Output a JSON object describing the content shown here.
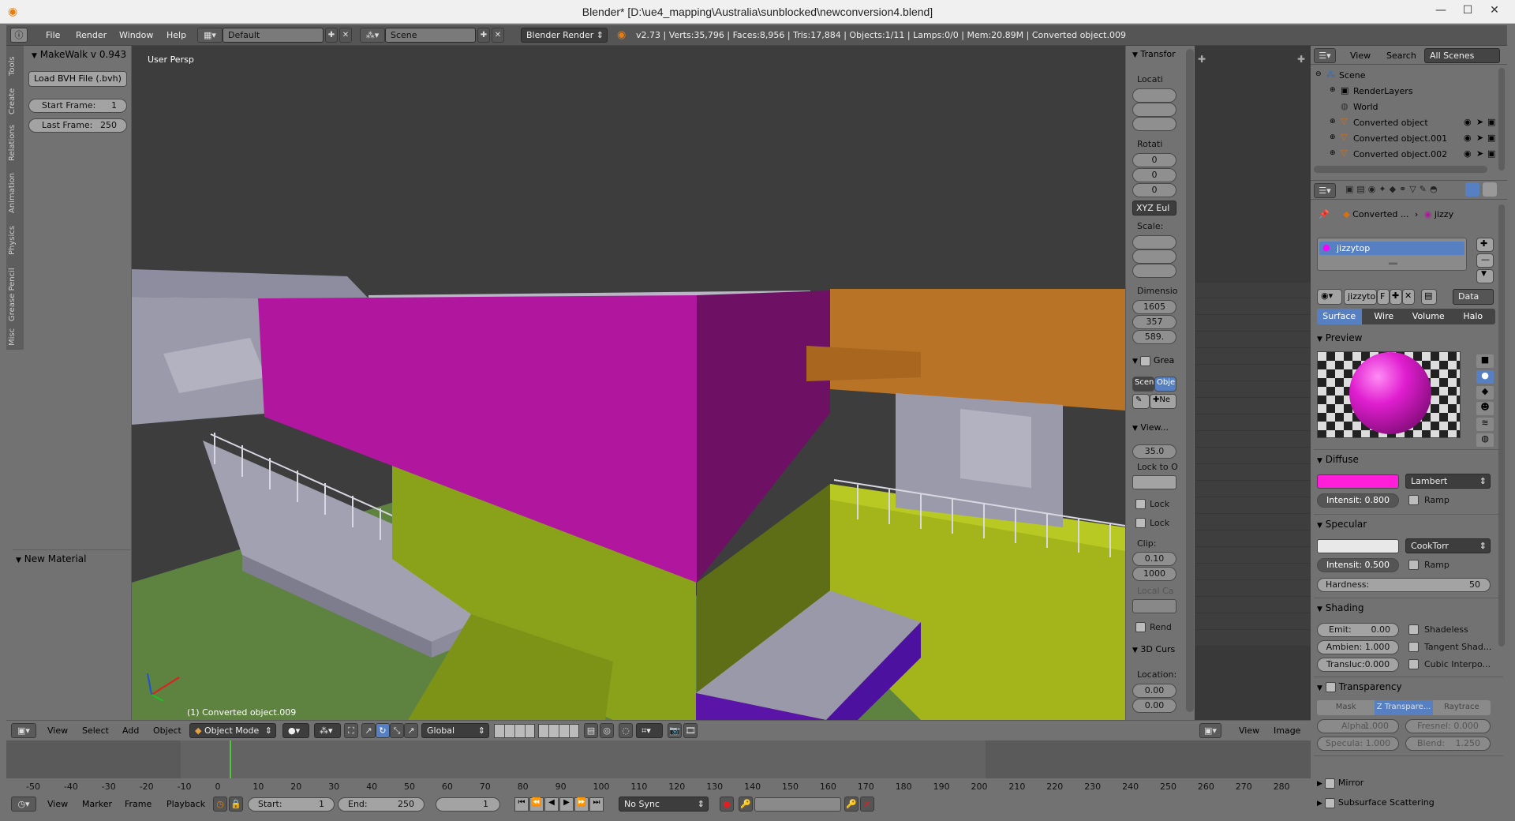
{
  "window": {
    "title": "Blender* [D:\\ue4_mapping\\Australia\\sunblocked\\newconversion4.blend]"
  },
  "infobar": {
    "menus": [
      "File",
      "Render",
      "Window",
      "Help"
    ],
    "layout": "Default",
    "scene": "Scene",
    "engine": "Blender Render",
    "stats": "v2.73 | Verts:35,796 | Faces:8,956 | Tris:17,884 | Objects:1/11 | Lamps:0/0 | Mem:20.89M | Converted object.009"
  },
  "toolshelf": {
    "tabs": [
      "Tools",
      "Create",
      "Relations",
      "Animation",
      "Physics",
      "Grease Pencil",
      "Misc"
    ],
    "panel_title": "MakeWalk v 0.943",
    "load_bvh": "Load BVH File (.bvh)",
    "start_frame_label": "Start Frame:",
    "start_frame_value": "1",
    "last_frame_label": "Last Frame:",
    "last_frame_value": "250",
    "operator_panel": "New Material"
  },
  "viewport": {
    "label": "User Persp",
    "object_label": "(1) Converted object.009",
    "colors": {
      "magenta": "#b0169e",
      "magenta_dark": "#6e1164",
      "lime": "#8aa11a",
      "lime_dark": "#5d6e16",
      "orange": "#b97327",
      "purple": "#5b14a8",
      "grey": "#9b9aaa",
      "ground": "#5e8240"
    }
  },
  "npanel": {
    "transform": "Transfor",
    "location": "Locati",
    "rotation": "Rotati",
    "rot_values": [
      "0",
      "0",
      "0"
    ],
    "rotation_mode": "XYZ Eul",
    "scale": "Scale:",
    "dimensions": "Dimensio",
    "dim_values": [
      "1605",
      "357",
      "589."
    ],
    "grease": "Grea",
    "scene_btn": "Scen",
    "object_btn": "Obje",
    "new_btn": "Ne",
    "view": "View...",
    "lens": "35.0",
    "lock_to": "Lock to O",
    "lock1": "Lock",
    "lock2": "Lock",
    "clip": "Clip:",
    "clip_start": "0.10",
    "clip_end": "1000",
    "local_cam": "Local Ca",
    "render": "Rend",
    "cursor": "3D Curs",
    "cursor_loc": "Location:",
    "cursor_values": [
      "0.00",
      "0.00"
    ]
  },
  "outliner": {
    "menus": [
      "View",
      "Search"
    ],
    "filter": "All Scenes",
    "items": [
      {
        "label": "Scene",
        "depth": 0
      },
      {
        "label": "RenderLayers",
        "depth": 1
      },
      {
        "label": "World",
        "depth": 1
      },
      {
        "label": "Converted object",
        "depth": 1
      },
      {
        "label": "Converted object.001",
        "depth": 1
      },
      {
        "label": "Converted object.002",
        "depth": 1
      }
    ]
  },
  "properties": {
    "breadcrumb": [
      "Converted ...",
      "jizzy"
    ],
    "material_slot": "jizzytop",
    "material_name": "jizzyto",
    "fake_user": "F",
    "data_btn": "Data",
    "tabs": [
      "Surface",
      "Wire",
      "Volume",
      "Halo"
    ],
    "preview": "Preview",
    "diffuse": "Diffuse",
    "diffuse_color": "#ff1fd8",
    "diffuse_shader": "Lambert",
    "diffuse_intensity": "Intensit: 0.800",
    "ramp": "Ramp",
    "specular": "Specular",
    "specular_shader": "CookTorr",
    "specular_intensity": "Intensit: 0.500",
    "hardness_label": "Hardness:",
    "hardness_value": "50",
    "shading": "Shading",
    "emit": "Emit:",
    "emit_value": "0.00",
    "ambient": "Ambien: 1.000",
    "translucency": "Transluc:0.000",
    "shadeless": "Shadeless",
    "tangent": "Tangent Shad...",
    "cubic": "Cubic Interpo...",
    "transparency": "Transparency",
    "trans_tabs": [
      "Mask",
      "Z Transpare...",
      "Raytrace"
    ],
    "alpha": "Alpha:",
    "alpha_value": "1.000",
    "fresnel": "Fresnel: 0.000",
    "specular_alpha": "Specula: 1.000",
    "blend": "Blend:",
    "blend_value": "1.250",
    "mirror": "Mirror",
    "sss": "Subsurface Scattering"
  },
  "vpheader": {
    "menus": [
      "View",
      "Select",
      "Add",
      "Object"
    ],
    "mode": "Object Mode",
    "orientation": "Global"
  },
  "imageeditor": {
    "menus": [
      "View",
      "Image"
    ]
  },
  "timeline": {
    "ticks": [
      "-50",
      "-40",
      "-30",
      "-20",
      "-10",
      "0",
      "10",
      "20",
      "30",
      "40",
      "50",
      "60",
      "70",
      "80",
      "90",
      "100",
      "110",
      "120",
      "130",
      "140",
      "150",
      "160",
      "170",
      "180",
      "190",
      "200",
      "210",
      "220",
      "230",
      "240",
      "250",
      "260",
      "270",
      "280"
    ],
    "menus": [
      "View",
      "Marker",
      "Frame",
      "Playback"
    ],
    "start_label": "Start:",
    "start_value": "1",
    "end_label": "End:",
    "end_value": "250",
    "current": "1",
    "sync": "No Sync"
  }
}
